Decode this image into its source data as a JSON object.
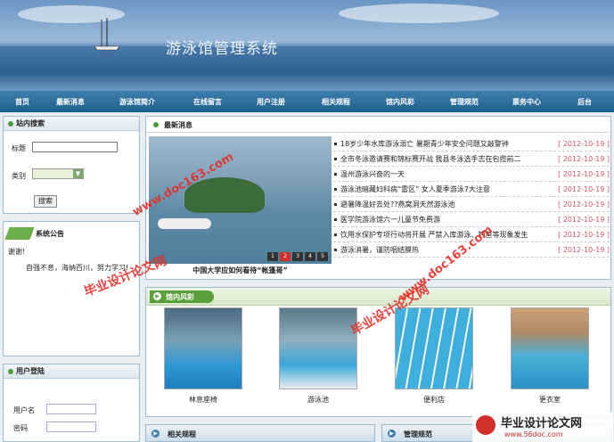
{
  "site": {
    "title": "游泳馆管理系统"
  },
  "nav": [
    "首页",
    "最新消息",
    "游泳馆简介",
    "在线留言",
    "用户注册",
    "相关规程",
    "馆内风彩",
    "管理规范",
    "票务中心",
    "后台"
  ],
  "search": {
    "title": "站内搜索",
    "label_title": "标题",
    "label_category": "类别",
    "button": "搜索"
  },
  "notice": {
    "title": "系统公告",
    "line1": "谢谢!",
    "line2": "自强不息，海纳百川，努力学习!"
  },
  "login": {
    "title": "用户登陆",
    "label_user": "用户名",
    "label_pass": "密码"
  },
  "latest": {
    "title": "最新消息",
    "caption": "中国大学应如何看待“帐篷哥”",
    "slider_pages": [
      "1",
      "2",
      "3",
      "4",
      "5"
    ],
    "active_page": "2",
    "items": [
      {
        "text": "18岁少年水库游泳溺亡 暑期青少年安全问题又敲警钟",
        "date": "[ 2012-10-19 ]"
      },
      {
        "text": "全市冬泳邀请赛和锦标赛开战 我县冬泳选手志在包揽前二",
        "date": "[ 2012-10-19 ]"
      },
      {
        "text": "温州游泳兴奋的一天",
        "date": "[ 2012-10-19 ]"
      },
      {
        "text": "游泳池暗藏妇科病“雷区” 女人夏季游泳7大注意",
        "date": "[ 2012-10-19 ]"
      },
      {
        "text": "避暑降温好去处??燕窝洞天然游泳池",
        "date": "[ 2012-10-19 ]"
      },
      {
        "text": "医学院游泳馆六一儿童节免费游",
        "date": "[ 2012-10-19 ]"
      },
      {
        "text": "饮用水保护专项行动将开展 严禁入库游泳、钓鱼等现象发生",
        "date": "[ 2012-10-19 ]"
      },
      {
        "text": "游泳消暑，谨防咽结膜热",
        "date": "[ 2012-10-19 ]"
      }
    ]
  },
  "gallery": {
    "title": "馆内风彩",
    "photos": [
      {
        "caption": "林息座椅"
      },
      {
        "caption": "游泳池"
      },
      {
        "caption": "便利店"
      },
      {
        "caption": "更衣室"
      }
    ]
  },
  "bottom": {
    "left_title": "相关规程",
    "right_title": "管理规范"
  },
  "watermarks": [
    "毕业设计论文网",
    "www.doc163.com",
    "毕业设计论文网",
    "www.doc163.com",
    "毕业设计论文网",
    "www.56doc.com"
  ],
  "colors": {
    "nav_bg": "#2a6a99",
    "date": "#cc5566",
    "watermark": "#e0302a",
    "active_page": "#d0302a"
  }
}
